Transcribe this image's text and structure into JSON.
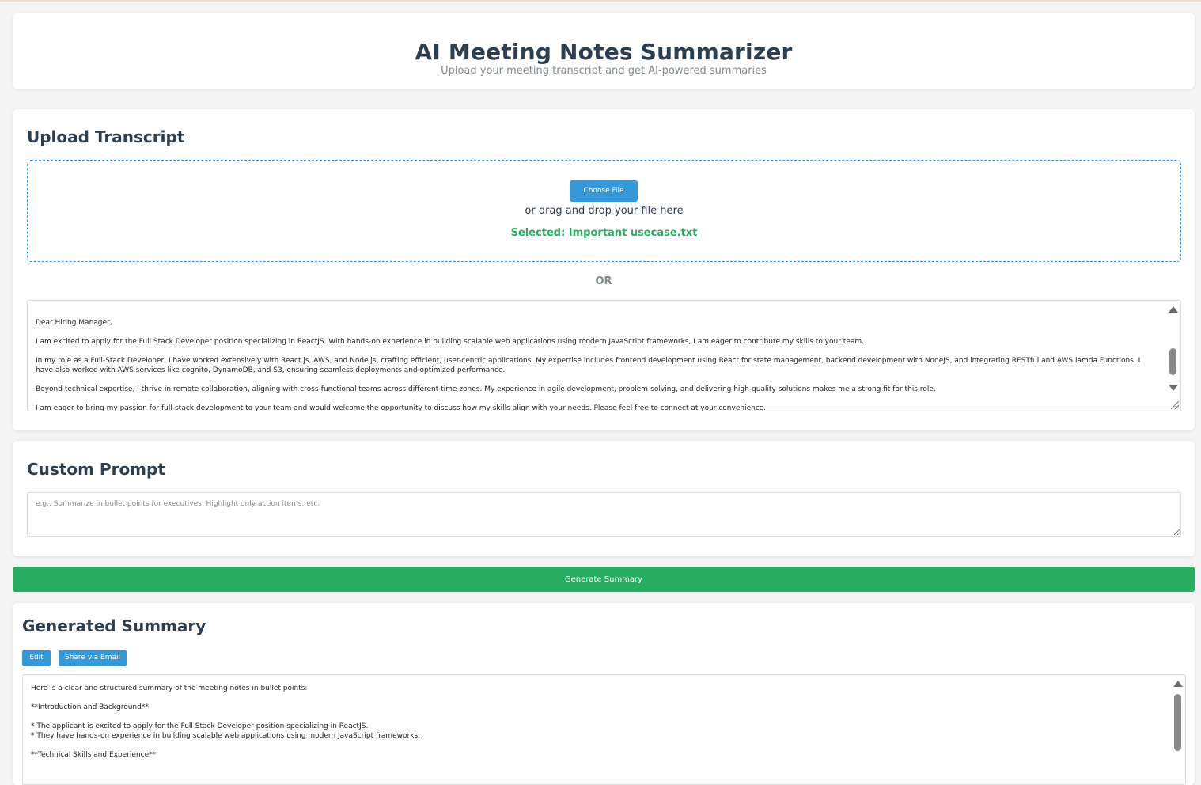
{
  "header": {
    "title": "AI Meeting Notes Summarizer",
    "subtitle": "Upload your meeting transcript and get AI-powered summaries"
  },
  "upload": {
    "title": "Upload Transcript",
    "choose_file_label": "Choose File",
    "drag_hint": "or drag and drop your file here",
    "selected_file": "Selected: Important usecase.txt",
    "or_label": "OR",
    "transcript_text": "Dear Hiring Manager,\n\nI am excited to apply for the Full Stack Developer position specializing in ReactJS. With hands-on experience in building scalable web applications using modern JavaScript frameworks, I am eager to contribute my skills to your team.\n\nIn my role as a Full-Stack Developer, I have worked extensively with React.js, AWS, and Node.js, crafting efficient, user-centric applications. My expertise includes frontend development using React for state management, backend development with NodeJS, and integrating RESTful and AWS lamda Functions. I have also worked with AWS services like cognito, DynamoDB, and S3, ensuring seamless deployments and optimized performance.\n\nBeyond technical expertise, I thrive in remote collaboration, aligning with cross-functional teams across different time zones. My experience in agile development, problem-solving, and delivering high-quality solutions makes me a strong fit for this role.\n\nI am eager to bring my passion for full-stack development to your team and would welcome the opportunity to discuss how my skills align with your needs. Please feel free to connect at your convenience."
  },
  "prompt": {
    "title": "Custom Prompt",
    "placeholder": "e.g., Summarize in bullet points for executives, Highlight only action items, etc."
  },
  "generate": {
    "label": "Generate Summary"
  },
  "summary": {
    "title": "Generated Summary",
    "edit_label": "Edit",
    "share_label": "Share via Email",
    "text": "Here is a clear and structured summary of the meeting notes in bullet points:\n\n**Introduction and Background**\n\n* The applicant is excited to apply for the Full Stack Developer position specializing in ReactJS.\n* They have hands-on experience in building scalable web applications using modern JavaScript frameworks.\n\n**Technical Skills and Experience**"
  },
  "colors": {
    "primary": "#3498db",
    "success": "#27ae60",
    "heading": "#2c3e50",
    "muted": "#7f8c8d"
  }
}
